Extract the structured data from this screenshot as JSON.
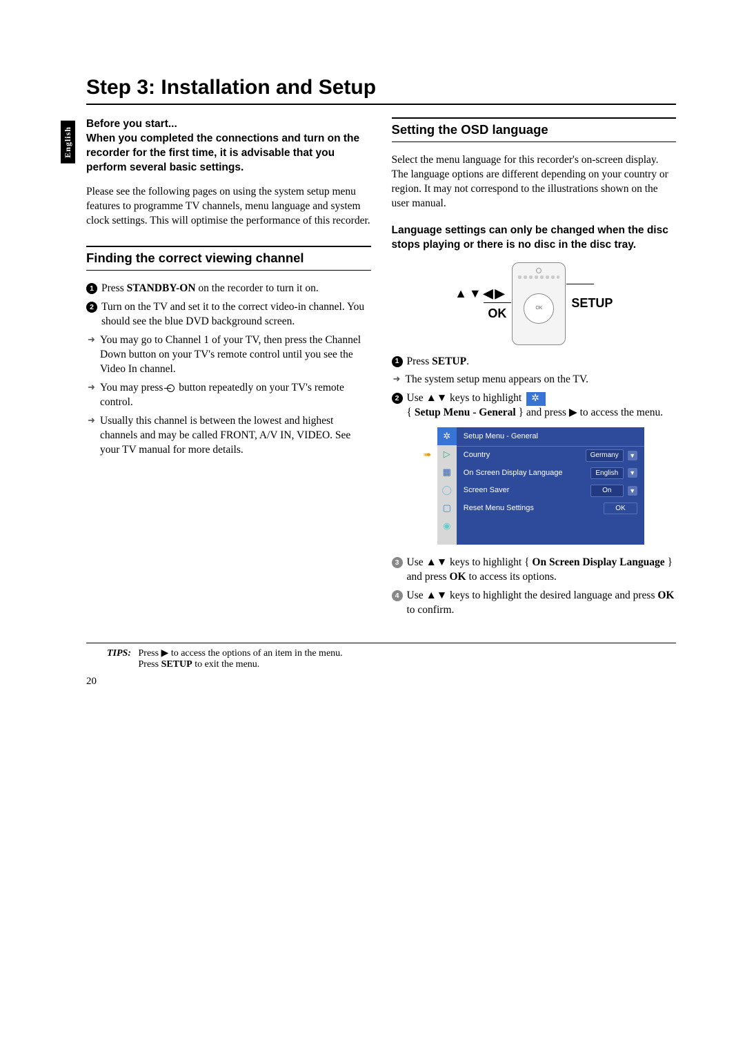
{
  "lang_tab": "English",
  "page_title": "Step 3: Installation and Setup",
  "left": {
    "before_label": "Before you start...",
    "before_body": "When you completed the connections and turn on the recorder for the first time, it is advisable that you perform several basic settings.",
    "intro_para": "Please see the following pages on using the system setup menu features to programme TV channels, menu language and system clock settings. This will optimise the performance of this recorder.",
    "section_finding": "Finding the correct viewing channel",
    "s1_a": "Press ",
    "s1_bold": "STANDBY-ON",
    "s1_b": " on the recorder to turn it on.",
    "s2": "Turn on the TV and set it to the correct video-in channel. You should see the blue DVD background screen.",
    "arrow1": "You may go to Channel 1 of your TV, then press the Channel Down button on your TV's remote control until you see the Video In channel.",
    "arrow2a": "You may press ",
    "arrow2b": " button repeatedly on your TV's remote control.",
    "arrow3": "Usually this channel is between the lowest and highest channels and may be called FRONT, A/V IN, VIDEO. See your TV manual for more details."
  },
  "right": {
    "section_osd": "Setting the OSD language",
    "osd_intro": "Select the menu language for this recorder's on-screen display.  The language options are different depending on your country or region.  It may not correspond to the illustrations shown on the user manual.",
    "osd_bold": "Language settings can only be changed when the disc stops playing or there is no disc in the disc tray.",
    "remote_arrows": "▲▼◀▶",
    "remote_ok": "OK",
    "remote_setup": "SETUP",
    "r1_a": "Press ",
    "r1_bold": "SETUP",
    "r1_b": ".",
    "r1_arrow": "The system setup menu appears on the TV.",
    "r2_a": "Use ▲▼ keys to highlight ",
    "r2_b": "{ ",
    "r2_bold": "Setup Menu - General",
    "r2_c": " } and press ▶ to access the menu.",
    "menu": {
      "title": "Setup Menu - General",
      "rows": [
        {
          "label": "Country",
          "value": "Germany",
          "dd": true
        },
        {
          "label": "On Screen Display Language",
          "value": "English",
          "dd": true
        },
        {
          "label": "Screen Saver",
          "value": "On",
          "dd": true
        },
        {
          "label": "Reset Menu Settings",
          "value": "OK",
          "dd": false
        }
      ]
    },
    "r3_a": "Use ▲▼ keys to highlight { ",
    "r3_bold": "On Screen Display Language",
    "r3_b": " } and press ",
    "r3_ok": "OK",
    "r3_c": " to access its options.",
    "r4_a": "Use ▲▼ keys to highlight the desired language and press ",
    "r4_ok": "OK",
    "r4_b": " to confirm."
  },
  "tips": {
    "label": "TIPS:",
    "line1": "Press ▶ to access the options of an item in the menu.",
    "line2a": "Press ",
    "line2bold": "SETUP",
    "line2b": " to exit the menu."
  },
  "page_number": "20"
}
